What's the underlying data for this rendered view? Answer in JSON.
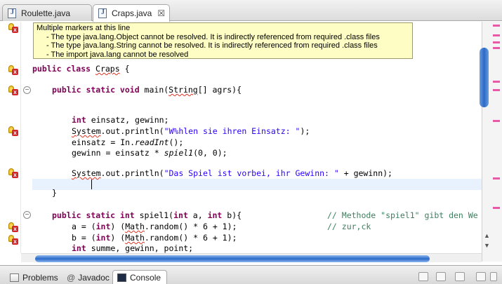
{
  "tabs": [
    {
      "label": "Roulette.java",
      "icon": "java-file-icon",
      "active": false
    },
    {
      "label": "Craps.java",
      "icon": "java-file-icon",
      "active": true,
      "close": "☒"
    }
  ],
  "tooltip": {
    "title": "Multiple markers at this line",
    "messages": [
      "- The type java.lang.Object cannot be resolved. It is indirectly referenced from required .class files",
      "- The type java.lang.String cannot be resolved. It is indirectly referenced from required .class files",
      "- The import java.lang cannot be resolved"
    ]
  },
  "code": {
    "l_class_kw": "public class ",
    "l_class_name": "Craps",
    "l_class_tail": " {",
    "l_main_kw": "public static void",
    "l_main_mid": " main(",
    "l_main_string": "String",
    "l_main_tail": "[] agrs){",
    "l_decl_kw": "int",
    "l_decl_tail": " einsatz, gewinn;",
    "l_print1_sys": "System",
    "l_print1_mid": ".out.println(",
    "l_print1_str": "\"W%hlen sie ihren Einsatz: \"",
    "l_print1_tail": ");",
    "l_read_head": "einsatz = In.",
    "l_read_call": "readInt",
    "l_read_tail": "();",
    "l_gewinn_head": "gewinn = einsatz * ",
    "l_gewinn_call": "spiel1",
    "l_gewinn_tail": "(0, 0);",
    "l_print2_sys": "System",
    "l_print2_mid": ".out.println(",
    "l_print2_str": "\"Das Spiel ist vorbei, ihr Gewinn: \"",
    "l_print2_tail": " + gewinn);",
    "l_close": "}",
    "l_spiel_kw1": "public static int",
    "l_spiel_mid1": " spiel1(",
    "l_spiel_kw2": "int",
    "l_spiel_mid2": " a, ",
    "l_spiel_kw3": "int",
    "l_spiel_tail": " b){",
    "l_spiel_comment": "// Methode \"spiel1\" gibt den We",
    "l_a_head": "a = (",
    "l_a_kw": "int",
    "l_a_mid": ") (",
    "l_a_math": "Math",
    "l_a_tail": ".random() * 6 + 1);",
    "l_a_comment": "// zur,ck",
    "l_b_head": "b = (",
    "l_b_kw": "int",
    "l_b_mid": ") (",
    "l_b_math": "Math",
    "l_b_tail": ".random() * 6 + 1);",
    "l_last_kw": "int",
    "l_last_tail": " summe, gewinn, point;"
  },
  "bottom_tabs": [
    {
      "label": "Problems",
      "icon": "problems-icon",
      "active": false
    },
    {
      "label": "Javadoc",
      "icon": "at-icon",
      "active": false
    },
    {
      "label": "Console",
      "icon": "console-icon",
      "active": true
    }
  ],
  "colors": {
    "keyword": "#7f0055",
    "string": "#2a00ff",
    "comment": "#3f7f5f",
    "error": "#e0321e",
    "tooltip_bg": "#fdfdc4"
  }
}
